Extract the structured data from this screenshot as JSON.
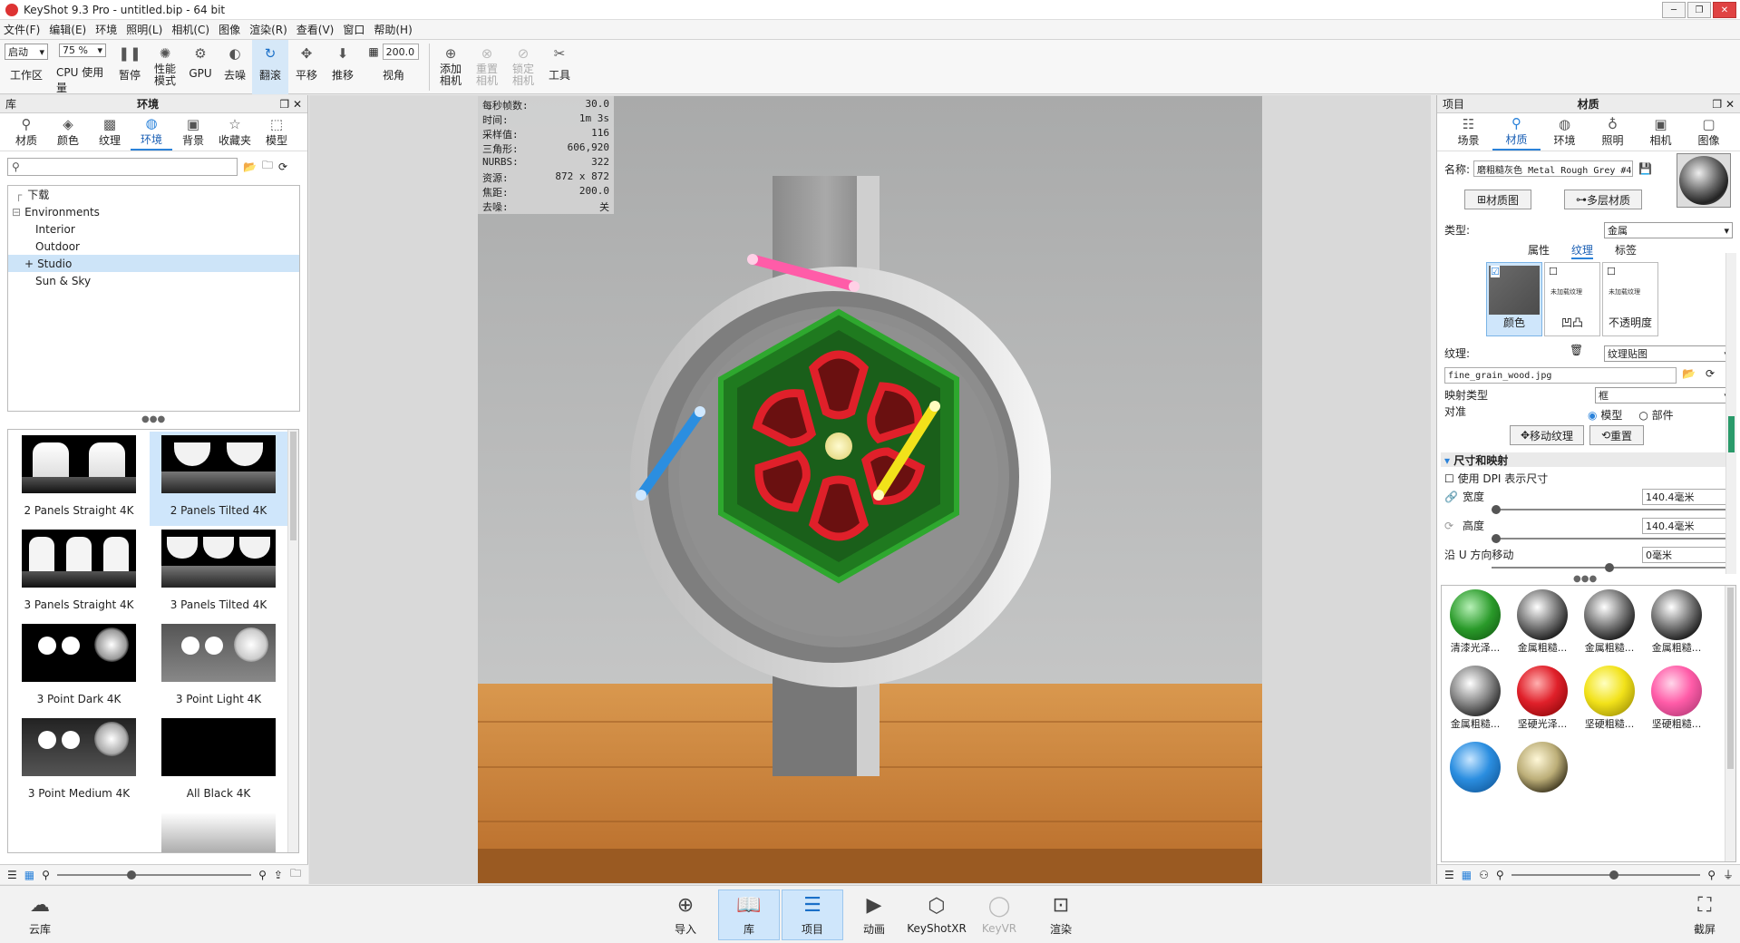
{
  "window": {
    "title": "KeyShot 9.3 Pro - untitled.bip - 64 bit"
  },
  "menu": [
    "文件(F)",
    "编辑(E)",
    "环境",
    "照明(L)",
    "相机(C)",
    "图像",
    "渲染(R)",
    "查看(V)",
    "窗口",
    "帮助(H)"
  ],
  "toolbar": {
    "mode_value": "启动",
    "zoom_value": "75 %",
    "fov_value": "200.0",
    "workspace": "工作区",
    "cpu": "CPU 使用量",
    "pause": "暂停",
    "perf_mode": "性能模式",
    "gpu": "GPU",
    "denoise": "去噪",
    "tumble": "翻滚",
    "pan": "平移",
    "dolly": "推移",
    "view": "视角",
    "add_camera": "添加相机",
    "reset_camera": "重置相机",
    "lock_camera": "锁定相机",
    "tools": "工具"
  },
  "library": {
    "header_left": "库",
    "header_title": "环境",
    "tabs": [
      "材质",
      "颜色",
      "纹理",
      "环境",
      "背景",
      "收藏夹",
      "模型"
    ],
    "tree": [
      "下载",
      "Environments",
      "Interior",
      "Outdoor",
      "Studio",
      "Sun & Sky"
    ],
    "thumbs": [
      "2 Panels Straight 4K",
      "2 Panels Tilted 4K",
      "3 Panels Straight 4K",
      "3 Panels Tilted 4K",
      "3 Point Dark 4K",
      "3 Point Light 4K",
      "3 Point Medium 4K",
      "All Black 4K"
    ]
  },
  "stats": [
    {
      "k": "每秒帧数:",
      "v": "30.0"
    },
    {
      "k": "时间:",
      "v": "1m 3s"
    },
    {
      "k": "采样值:",
      "v": "116"
    },
    {
      "k": "三角形:",
      "v": "606,920"
    },
    {
      "k": "NURBS:",
      "v": "322"
    },
    {
      "k": "资源:",
      "v": "872 x 872"
    },
    {
      "k": "焦距:",
      "v": "200.0"
    },
    {
      "k": "去噪:",
      "v": "关"
    }
  ],
  "project": {
    "header_left": "项目",
    "header_title": "材质",
    "tabs": [
      "场景",
      "材质",
      "环境",
      "照明",
      "相机",
      "图像"
    ],
    "name_label": "名称:",
    "name_value": "磨粗糙灰色 Metal Rough Grey #4",
    "material_graph": "材质图",
    "multi_layer": "多层材质",
    "type_label": "类型:",
    "type_value": "金属",
    "subtabs": [
      "属性",
      "纹理",
      "标签"
    ],
    "tex_slots": [
      "颜色",
      "凹凸",
      "不透明度"
    ],
    "tex_small": "未加载纹理",
    "texture_label": "纹理:",
    "texture_type": "纹理贴图",
    "texture_file": "fine_grain_wood.jpg",
    "mapping_label": "映射类型",
    "mapping_value": "框",
    "align_label": "对准",
    "align_model": "模型",
    "align_part": "部件",
    "move_texture": "移动纹理",
    "reset": "重置",
    "section": "尺寸和映射",
    "dpi_label": "使用 DPI 表示尺寸",
    "width_label": "宽度",
    "width_value": "140.4毫米",
    "height_label": "高度",
    "height_value": "140.4毫米",
    "umove_label": "沿 U 方向移动",
    "umove_value": "0毫米",
    "swatches": [
      "清漆光泽...",
      "金属粗糙...",
      "金属粗糙...",
      "金属粗糙...",
      "金属粗糙...",
      "坚硬光泽...",
      "坚硬粗糙...",
      "坚硬粗糙...",
      "",
      ""
    ]
  },
  "bottom": {
    "cloud": "云库",
    "import": "导入",
    "library": "库",
    "project": "项目",
    "animation": "动画",
    "keyshotxr": "KeyShotXR",
    "keyvr": "KeyVR",
    "render": "渲染",
    "screenshot": "截屏"
  },
  "colors": {
    "accent": "#2a82da",
    "pink": "#ff5ca8",
    "blue": "#2b8ee0",
    "yellow": "#f2e21a",
    "green": "#2a9a2a",
    "red": "#e0202a"
  }
}
